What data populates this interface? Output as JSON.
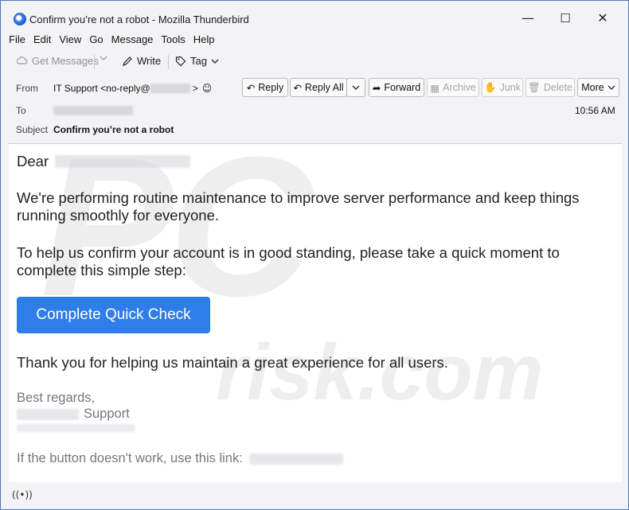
{
  "window": {
    "title": "Confirm you’re not a robot - Mozilla Thunderbird",
    "minimize": "—",
    "maximize": "☐",
    "close": "✕"
  },
  "menu": [
    "File",
    "Edit",
    "View",
    "Go",
    "Message",
    "Tools",
    "Help"
  ],
  "toolbar": {
    "get_messages": "Get Messages",
    "write": "Write",
    "tag": "Tag"
  },
  "header": {
    "from_label": "From",
    "from_value": "IT Support <no-reply@",
    "from_value_end": ">",
    "to_label": "To",
    "subject_label": "Subject",
    "subject_value": "Confirm you’re not a robot",
    "time": "10:56 AM",
    "buttons": {
      "reply": "Reply",
      "reply_all": "Reply All",
      "forward": "Forward",
      "archive": "Archive",
      "junk": "Junk",
      "delete": "Delete",
      "more": "More"
    }
  },
  "body": {
    "greeting": "Dear",
    "para1_line1": "We're performing routine maintenance to improve server performance and keep things",
    "para1_line2": "running smoothly for everyone.",
    "para2_line1": "To help us confirm your account is in good standing, please take a quick moment to",
    "para2_line2": "complete this simple step:",
    "cta": "Complete Quick Check",
    "thanks": "Thank you for helping us maintain a great experience for all users.",
    "regards": "Best regards,",
    "signature": "Support",
    "fallback": "If the button doesn't work, use this link:"
  },
  "watermark": {
    "top": "PC",
    "bottom": "risk.com"
  },
  "colors": {
    "accent": "#2f7de8",
    "window_border": "#4a7ab8"
  }
}
